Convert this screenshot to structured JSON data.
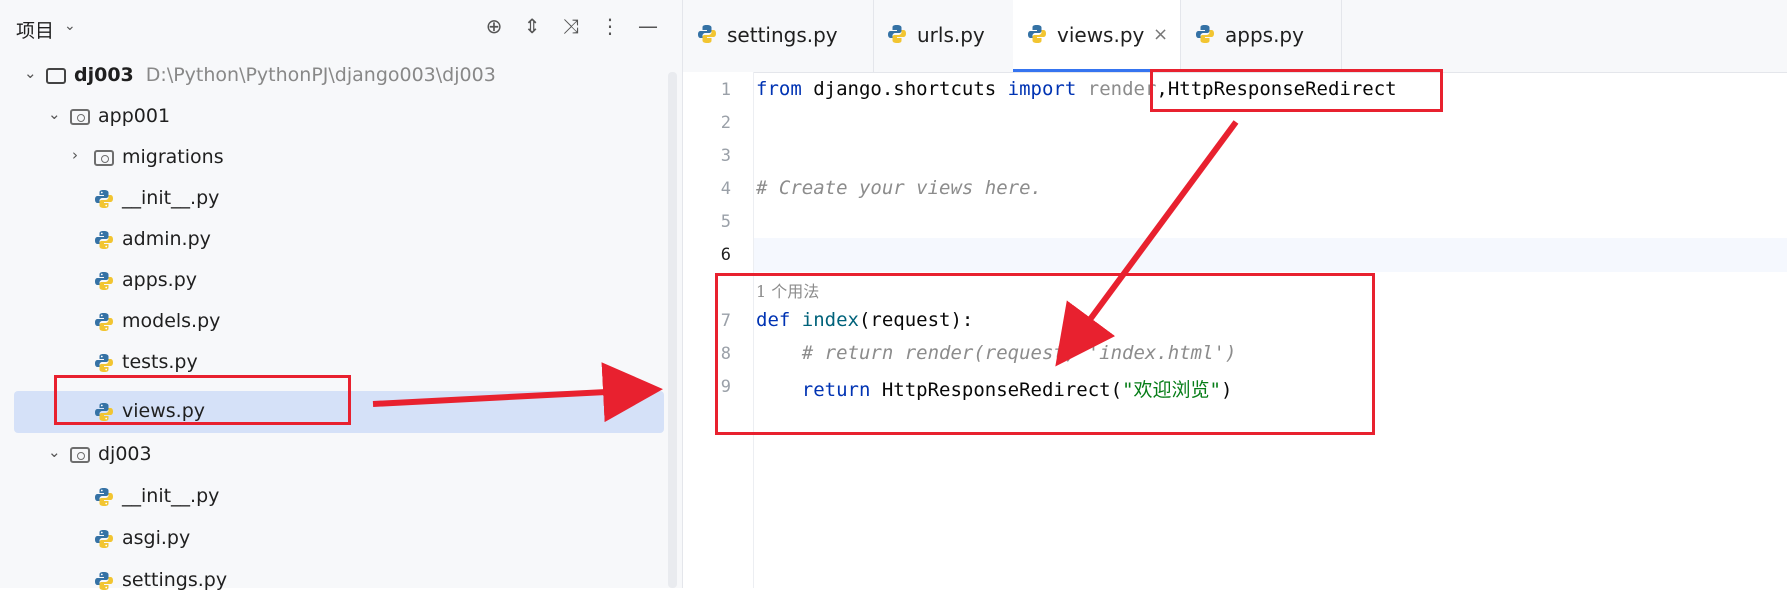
{
  "sidebar": {
    "title": "项目",
    "tree": [
      {
        "label": "dj003",
        "path": "D:\\Python\\PythonPJ\\django003\\dj003"
      },
      {
        "label": "app001"
      },
      {
        "label": "migrations"
      },
      {
        "label": "__init__.py"
      },
      {
        "label": "admin.py"
      },
      {
        "label": "apps.py"
      },
      {
        "label": "models.py"
      },
      {
        "label": "tests.py"
      },
      {
        "label": "views.py"
      },
      {
        "label": "dj003"
      },
      {
        "label": "__init__.py"
      },
      {
        "label": "asgi.py"
      },
      {
        "label": "settings.py"
      }
    ]
  },
  "tabs": [
    {
      "label": "settings.py"
    },
    {
      "label": "urls.py"
    },
    {
      "label": "views.py",
      "close": "×"
    },
    {
      "label": "apps.py"
    }
  ],
  "editor": {
    "line_numbers": [
      "1",
      "2",
      "3",
      "4",
      "5",
      "6",
      "7",
      "8",
      "9"
    ],
    "usage_hint": "1 个用法",
    "code": {
      "l1_from": "from",
      "l1_module": " django.shortcuts ",
      "l1_import": "import",
      "l1_render": " render",
      "l1_comma": ",",
      "l1_redirect": "HttpResponseRedirect",
      "l4_comment": "# Create your views here.",
      "l7_def": "def",
      "l7_name": " index",
      "l7_args": "(request):",
      "l8_comment": "    # return render(request, 'index.html')",
      "l9_return": "    return",
      "l9_call": " HttpResponseRedirect(",
      "l9_str": "\"欢迎浏览\"",
      "l9_close": ")"
    }
  },
  "colors": {
    "accent": "#3574f0",
    "annotation_red": "#e8212f",
    "selection": "#d5e1f8",
    "keyword": "#0033b3",
    "string": "#067d17",
    "comment": "#8c8c8c"
  }
}
